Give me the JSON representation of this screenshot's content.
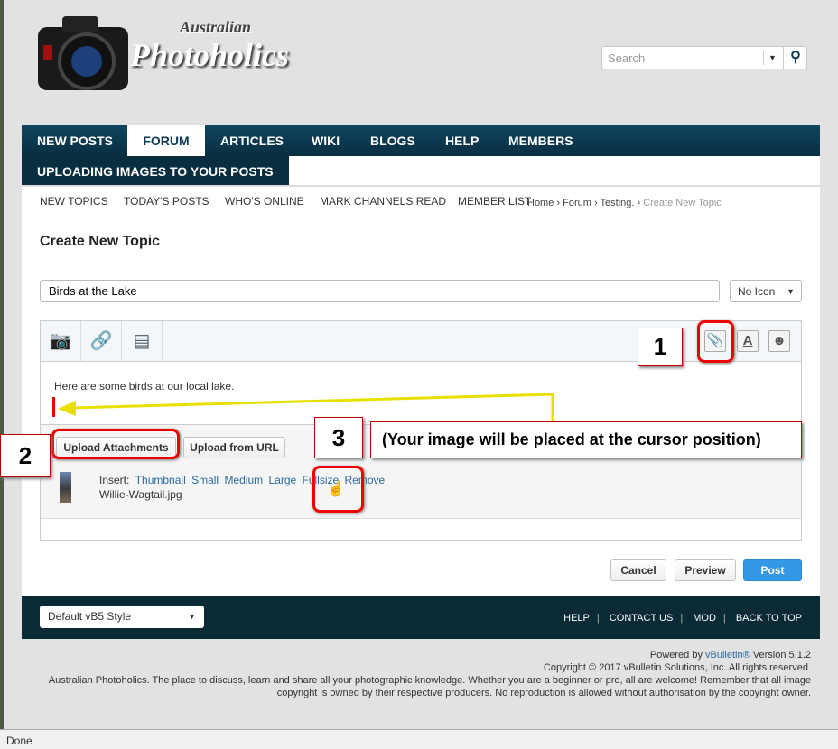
{
  "header": {
    "logo_text_top": "Australian",
    "logo_text_main": "Photoholics",
    "search_placeholder": "Search"
  },
  "nav": {
    "tabs": [
      {
        "label": "NEW POSTS"
      },
      {
        "label": "FORUM",
        "active": true
      },
      {
        "label": "ARTICLES"
      },
      {
        "label": "WIKI"
      },
      {
        "label": "BLOGS"
      },
      {
        "label": "HELP"
      },
      {
        "label": "MEMBERS"
      }
    ],
    "current_sub": "UPLOADING IMAGES TO YOUR POSTS",
    "subnav": [
      "NEW TOPICS",
      "TODAY'S POSTS",
      "WHO'S ONLINE",
      "MARK CHANNELS READ",
      "MEMBER LIST"
    ]
  },
  "breadcrumb": [
    "Home",
    "Forum",
    "Testing.",
    "Create New Topic"
  ],
  "page_title": "Create New Topic",
  "form": {
    "title_value": "Birds at the Lake",
    "icon_select": "No Icon",
    "body_text": "Here are some birds at our local lake.",
    "upload_attachments": "Upload Attachments",
    "upload_url": "Upload from URL",
    "insert_label": "Insert:",
    "insert_options": [
      "Thumbnail",
      "Small",
      "Medium",
      "Large",
      "Fullsize"
    ],
    "remove": "Remove",
    "file_name": "Willie-Wagtail.jpg",
    "cancel": "Cancel",
    "preview": "Preview",
    "post": "Post"
  },
  "annotations": {
    "n1": "1",
    "n2": "2",
    "n3": "3",
    "callout": "(Your image will be placed at the cursor position)"
  },
  "footer": {
    "style_select": "Default vB5 Style",
    "links": [
      "HELP",
      "CONTACT US",
      "MOD",
      "BACK TO TOP"
    ],
    "powered_prefix": "Powered by ",
    "powered_link": "vBulletin®",
    "powered_suffix": " Version 5.1.2",
    "copyright": "Copyright © 2017 vBulletin Solutions, Inc. All rights reserved.",
    "desc1": "Australian Photoholics. The place to discuss, learn and share all your photographic knowledge. Whether you are a beginner or pro, all are welcome! Remember that all image",
    "desc2": "copyright is owned by their respective producers. No reproduction is allowed without authorisation by the copyright owner."
  },
  "status_bar": "Done",
  "colors": {
    "nav": "#0b3a52",
    "footer": "#0a2a36",
    "post_button": "#3399e6",
    "annotation": "#e00000",
    "arrow": "#f5f000"
  }
}
